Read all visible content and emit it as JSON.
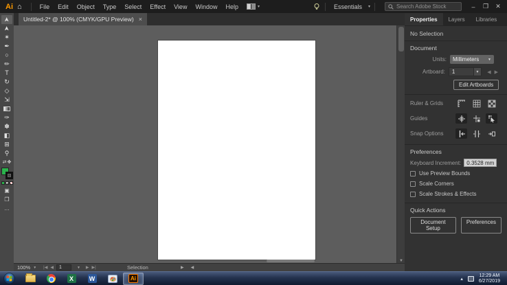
{
  "menubar": {
    "logo": "Ai",
    "home_glyph": "⌂",
    "items": [
      "File",
      "Edit",
      "Object",
      "Type",
      "Select",
      "Effect",
      "View",
      "Window",
      "Help"
    ],
    "workspace_label": "Essentials",
    "search_placeholder": "Search Adobe Stock",
    "window_controls": {
      "minimize": "–",
      "restore": "❐",
      "close": "✕"
    }
  },
  "document_tab": {
    "title": "Untitled-2* @ 100% (CMYK/GPU Preview)",
    "close": "×"
  },
  "toolbar": {
    "glyphs": [
      "➤",
      "➤",
      "✶",
      "✒",
      "○",
      "✏",
      "T",
      "↻",
      "◇",
      "⇲",
      "",
      "✑",
      "✽",
      "◧",
      "⊞",
      "⚲"
    ],
    "extra_glyphs": [
      "⇄",
      "✥"
    ],
    "draw_mode_glyph": "▣",
    "screen_mode_glyph": "❐",
    "edit_toolbar_glyph": "…",
    "fill_color": "#2bb24c",
    "stroke_color": "#111111"
  },
  "panel": {
    "tabs": [
      "Properties",
      "Layers",
      "Libraries"
    ],
    "no_selection": "No Selection",
    "document": {
      "header": "Document",
      "units_label": "Units:",
      "units_value": "Millimeters",
      "artboard_label": "Artboard:",
      "artboard_value": "1",
      "edit_artboards": "Edit Artboards"
    },
    "ruler_grids_label": "Ruler & Grids",
    "guides_label": "Guides",
    "snap_label": "Snap Options",
    "preferences": {
      "header": "Preferences",
      "keyboard_increment_label": "Keyboard Increment:",
      "keyboard_increment_value": "0.3528 mm",
      "checkboxes": [
        "Use Preview Bounds",
        "Scale Corners",
        "Scale Strokes & Effects"
      ]
    },
    "quick_actions": {
      "header": "Quick Actions",
      "document_setup": "Document Setup",
      "preferences_button": "Preferences"
    }
  },
  "statusbar": {
    "zoom": "100%",
    "nav_first": "|◀",
    "nav_prev": "◀",
    "artboard_value": "1",
    "nav_next": "▶",
    "nav_last": "▶|",
    "status": "Selection",
    "flyout_right": "▶",
    "flyout_left": "◀"
  },
  "taskbar": {
    "ai_label": "Ai",
    "excel_label": "X",
    "word_label": "W",
    "tray_expand": "▴",
    "time": "12:29 AM",
    "date": "6/27/2019"
  }
}
